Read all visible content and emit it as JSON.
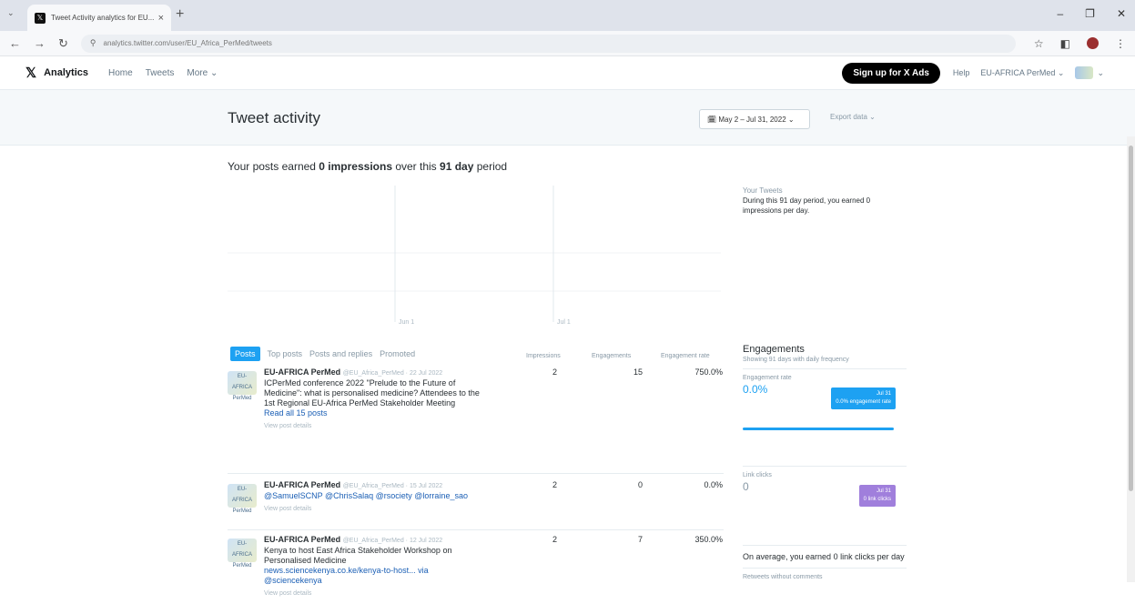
{
  "browser": {
    "tab_title": "Tweet Activity analytics for EU...",
    "url": "analytics.twitter.com/user/EU_Africa_PerMed/tweets",
    "tab_close": "×",
    "new_tab": "+"
  },
  "header": {
    "logo": "𝕏",
    "brand": "Analytics",
    "nav": [
      "Home",
      "Tweets",
      "More ⌄"
    ],
    "ads_button": "Sign up for X Ads",
    "help": "Help",
    "account": "EU-AFRICA PerMed ⌄"
  },
  "title_bar": {
    "title": "Tweet activity",
    "date_range": "🗓 May 2 – Jul 31, 2022 ⌄",
    "export": "Export data ⌄"
  },
  "summary": {
    "prefix": "Your posts earned ",
    "impressions": "0 impressions",
    "middle": " over this ",
    "days": "91 day",
    "suffix": " period"
  },
  "side_summary": {
    "label": "Your Tweets",
    "text": "During this 91 day period, you earned 0 impressions per day."
  },
  "chart_data": {
    "type": "bar",
    "x_ticks": [
      "Jun 1",
      "Jul 1"
    ],
    "values": [],
    "title": ""
  },
  "tabs": [
    "Posts",
    "Top posts",
    "Posts and replies",
    "Promoted"
  ],
  "columns": [
    "Impressions",
    "Engagements",
    "Engagement rate"
  ],
  "tweets": [
    {
      "author": "EU-AFRICA PerMed",
      "handle": "@EU_Africa_PerMed · 22 Jul 2022",
      "text": "ICPerMed conference 2022 \"Prelude to the Future of Medicine\": what is personalised medicine? Attendees to the 1st Regional EU-Africa PerMed Stakeholder Meeting",
      "link": "Read all 15 posts",
      "details": "View post details",
      "impressions": "2",
      "engagements": "15",
      "rate": "750.0%"
    },
    {
      "author": "EU-AFRICA PerMed",
      "handle": "@EU_Africa_PerMed · 15 Jul 2022",
      "text": "",
      "link": "@SamuelSCNP @ChrisSalaq @rsociety @lorraine_sao",
      "details": "View post details",
      "impressions": "2",
      "engagements": "0",
      "rate": "0.0%"
    },
    {
      "author": "EU-AFRICA PerMed",
      "handle": "@EU_Africa_PerMed · 12 Jul 2022",
      "text": "Kenya to host East Africa Stakeholder Workshop on Personalised Medicine",
      "link": "news.sciencekenya.co.ke/kenya-to-host... via @sciencekenya",
      "details": "View post details",
      "impressions": "2",
      "engagements": "7",
      "rate": "350.0%"
    }
  ],
  "engagements_panel": {
    "title": "Engagements",
    "subtitle": "Showing 91 days with daily frequency",
    "rate_label": "Engagement rate",
    "rate_value": "0.0%",
    "rate_tip": "Jul 31\n0.0% engagement rate",
    "clicks_label": "Link clicks",
    "clicks_value": "0",
    "clicks_tip": "Jul 31\n0 link clicks",
    "avg_text": "On average, you earned 0 link clicks per day",
    "retweets_label": "Retweets without comments"
  }
}
